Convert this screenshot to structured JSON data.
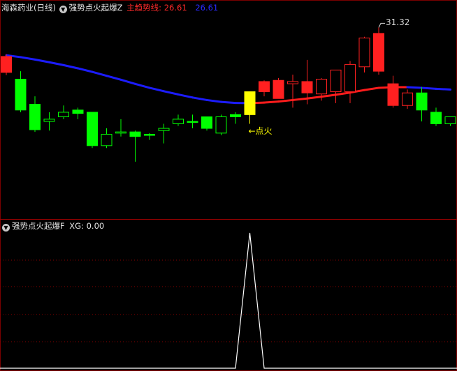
{
  "header": {
    "stock_name": "海森药业",
    "period": "(日线)",
    "indicator_name": "强势点火起爆Z",
    "main_trend_label": "主趋势线:",
    "main_trend_value": "26.61",
    "second_value": "26.61",
    "colors": {
      "white": "#e6e6e6",
      "red": "#ff2a2a",
      "blue": "#2a2aff"
    }
  },
  "sub_header": {
    "indicator_name": "强势点火起爆F",
    "xg_label": "XG:",
    "xg_value": "0.00"
  },
  "annotations": {
    "high_label": "31.32",
    "signal_label": "←点火"
  },
  "icons": [
    "chevron-down-icon",
    "chevron-down-icon"
  ],
  "chart_data": [
    {
      "type": "candlestick",
      "title": "强势点火起爆Z",
      "ylim": [
        20.6,
        32.2
      ],
      "colors": {
        "up": "#ff2020",
        "down": "#00ff00",
        "signal": "#ffff00",
        "trend_down": "#1c1cff",
        "trend_up": "#ff1c1c"
      },
      "candles": [
        {
          "o": 29.61,
          "h": 29.74,
          "l": 28.51,
          "c": 28.67,
          "color": "up"
        },
        {
          "o": 28.27,
          "h": 28.74,
          "l": 26.32,
          "c": 26.45,
          "color": "down"
        },
        {
          "o": 26.79,
          "h": 27.26,
          "l": 25.16,
          "c": 25.29,
          "color": "down"
        },
        {
          "o": 25.78,
          "h": 26.32,
          "l": 25.24,
          "c": 25.91,
          "color": "down",
          "hollow": true
        },
        {
          "o": 26.32,
          "h": 26.72,
          "l": 25.91,
          "c": 26.05,
          "color": "down",
          "hollow": true
        },
        {
          "o": 26.45,
          "h": 26.59,
          "l": 25.91,
          "c": 26.25,
          "color": "down"
        },
        {
          "o": 26.32,
          "h": 26.32,
          "l": 24.21,
          "c": 24.35,
          "color": "down"
        },
        {
          "o": 24.35,
          "h": 25.37,
          "l": 24.21,
          "c": 25.02,
          "color": "down",
          "hollow": true
        },
        {
          "o": 25.16,
          "h": 25.91,
          "l": 24.89,
          "c": 25.09,
          "color": "down",
          "hollow": true
        },
        {
          "o": 25.16,
          "h": 25.24,
          "l": 23.4,
          "c": 24.89,
          "color": "down"
        },
        {
          "o": 24.96,
          "h": 25.09,
          "l": 24.69,
          "c": 25.02,
          "color": "down"
        },
        {
          "o": 25.37,
          "h": 25.64,
          "l": 24.48,
          "c": 25.24,
          "color": "down",
          "hollow": true
        },
        {
          "o": 25.64,
          "h": 26.18,
          "l": 25.51,
          "c": 25.91,
          "color": "down",
          "hollow": true
        },
        {
          "o": 25.78,
          "h": 26.18,
          "l": 25.37,
          "c": 25.78,
          "color": "down"
        },
        {
          "o": 26.05,
          "h": 26.05,
          "l": 25.24,
          "c": 25.37,
          "color": "down"
        },
        {
          "o": 25.09,
          "h": 26.18,
          "l": 24.96,
          "c": 26.05,
          "color": "down",
          "hollow": true
        },
        {
          "o": 26.05,
          "h": 26.32,
          "l": 25.64,
          "c": 26.18,
          "color": "down"
        },
        {
          "o": 26.18,
          "h": 27.53,
          "l": 25.64,
          "c": 27.53,
          "color": "signal"
        },
        {
          "o": 27.53,
          "h": 28.2,
          "l": 27.26,
          "c": 28.13,
          "color": "up"
        },
        {
          "o": 27.13,
          "h": 28.34,
          "l": 27.13,
          "c": 28.2,
          "color": "up"
        },
        {
          "o": 28.13,
          "h": 28.54,
          "l": 26.59,
          "c": 28.0,
          "color": "up",
          "hollow": true
        },
        {
          "o": 27.46,
          "h": 29.41,
          "l": 26.79,
          "c": 28.13,
          "color": "up"
        },
        {
          "o": 27.4,
          "h": 28.34,
          "l": 27.0,
          "c": 28.27,
          "color": "up",
          "hollow": true
        },
        {
          "o": 27.53,
          "h": 28.81,
          "l": 26.86,
          "c": 28.81,
          "color": "up",
          "hollow": true
        },
        {
          "o": 27.53,
          "h": 29.34,
          "l": 26.86,
          "c": 29.14,
          "color": "up",
          "hollow": true
        },
        {
          "o": 29.0,
          "h": 30.77,
          "l": 28.67,
          "c": 30.7,
          "color": "up",
          "hollow": true
        },
        {
          "o": 28.74,
          "h": 31.32,
          "l": 28.54,
          "c": 30.97,
          "color": "up"
        },
        {
          "o": 28.0,
          "h": 28.47,
          "l": 26.59,
          "c": 26.72,
          "color": "up"
        },
        {
          "o": 26.72,
          "h": 27.66,
          "l": 26.52,
          "c": 27.46,
          "color": "up",
          "hollow": true
        },
        {
          "o": 27.46,
          "h": 27.8,
          "l": 25.78,
          "c": 26.45,
          "color": "down"
        },
        {
          "o": 26.32,
          "h": 26.59,
          "l": 25.51,
          "c": 25.64,
          "color": "down"
        },
        {
          "o": 25.64,
          "h": 26.05,
          "l": 25.51,
          "c": 26.05,
          "color": "down",
          "hollow": true
        }
      ],
      "series": [
        {
          "values": [
            29.68,
            29.57,
            29.43,
            29.27,
            29.1,
            28.91,
            28.7,
            28.47,
            28.24,
            27.99,
            27.76,
            27.56,
            27.37,
            27.19,
            27.04,
            26.93,
            26.87,
            26.86,
            26.89,
            26.95,
            27.04,
            27.13,
            27.24,
            27.35,
            27.48,
            27.63,
            27.76,
            27.8,
            27.8,
            27.76,
            27.7,
            27.66
          ]
        }
      ]
    },
    {
      "type": "line",
      "title": "强势点火起爆F",
      "ylim": [
        0,
        1
      ],
      "series": [
        {
          "name": "XG",
          "values": [
            0,
            0,
            0,
            0,
            0,
            0,
            0,
            0,
            0,
            0,
            0,
            0,
            0,
            0,
            0,
            0,
            0,
            1,
            0,
            0,
            0,
            0,
            0,
            0,
            0,
            0,
            0,
            0,
            0,
            0,
            0,
            0
          ]
        }
      ]
    }
  ]
}
